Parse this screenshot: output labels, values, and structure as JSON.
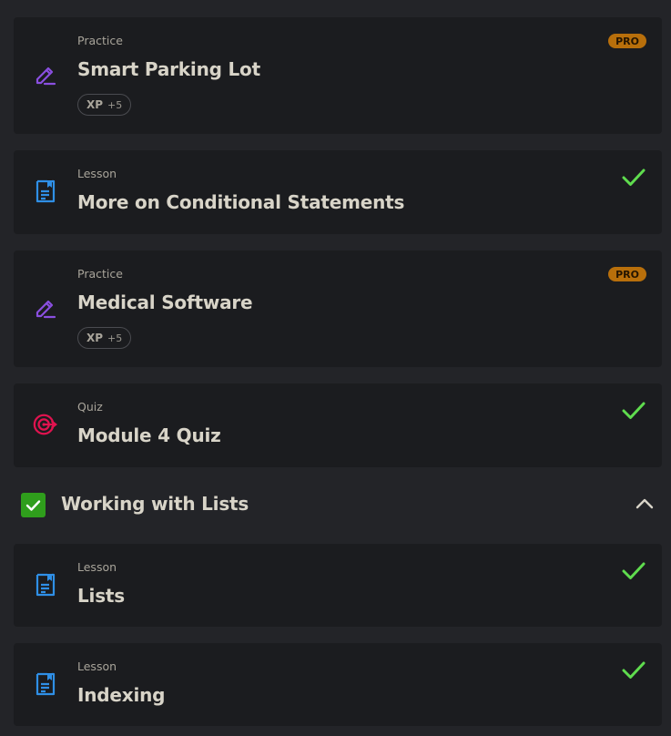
{
  "items": [
    {
      "type": "Practice",
      "title": "Smart Parking Lot",
      "xp_label": "XP",
      "xp_value": "+5",
      "badge": "PRO",
      "icon": "pencil-icon"
    },
    {
      "type": "Lesson",
      "title": "More on Conditional Statements",
      "completed": true,
      "icon": "document-icon"
    },
    {
      "type": "Practice",
      "title": "Medical Software",
      "xp_label": "XP",
      "xp_value": "+5",
      "badge": "PRO",
      "icon": "pencil-icon"
    },
    {
      "type": "Quiz",
      "title": "Module 4 Quiz",
      "completed": true,
      "icon": "target-icon"
    }
  ],
  "section": {
    "title": "Working with Lists",
    "completed": true,
    "expanded": true
  },
  "section_items": [
    {
      "type": "Lesson",
      "title": "Lists",
      "completed": true,
      "icon": "document-icon"
    },
    {
      "type": "Lesson",
      "title": "Indexing",
      "completed": true,
      "icon": "document-icon"
    }
  ],
  "colors": {
    "background": "#232428",
    "card": "#1b1c1f",
    "pro_badge": "#b86f0b",
    "check": "#5fdc4e",
    "practice_icon": "#8a4fe0",
    "lesson_icon": "#2f8fe6",
    "quiz_icon": "#e0134f",
    "section_check": "#2f9e1c"
  }
}
